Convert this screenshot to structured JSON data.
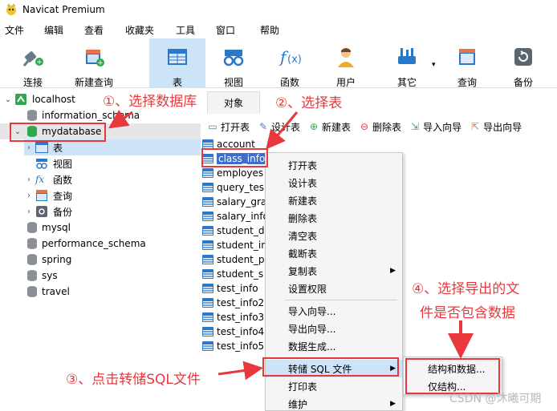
{
  "app": {
    "title": "Navicat Premium"
  },
  "menu": [
    "文件",
    "编辑",
    "查看",
    "收藏夹",
    "工具",
    "窗口",
    "帮助"
  ],
  "toolbar": [
    {
      "label": "连接",
      "icon": "plug-icon"
    },
    {
      "label": "新建查询",
      "icon": "new-query-icon"
    },
    {
      "label": "表",
      "icon": "table-icon"
    },
    {
      "label": "视图",
      "icon": "view-icon"
    },
    {
      "label": "函数",
      "icon": "function-icon"
    },
    {
      "label": "用户",
      "icon": "user-icon"
    },
    {
      "label": "其它",
      "icon": "tools-icon"
    },
    {
      "label": "查询",
      "icon": "query-icon"
    },
    {
      "label": "备份",
      "icon": "backup-icon"
    }
  ],
  "tree": {
    "connection": "localhost",
    "items": [
      "information_schema",
      "mydatabase",
      "表",
      "视图",
      "函数",
      "查询",
      "备份",
      "mysql",
      "performance_schema",
      "spring",
      "sys",
      "travel"
    ]
  },
  "objects": {
    "tab": "对象",
    "actions": [
      "打开表",
      "设计表",
      "新建表",
      "删除表",
      "导入向导",
      "导出向导"
    ],
    "tables": [
      "account",
      "class_info",
      "employes",
      "query_tes",
      "salary_gra",
      "salary_info",
      "student_d",
      "student_in",
      "student_p",
      "student_s",
      "test_info",
      "test_info2",
      "test_info3",
      "test_info4",
      "test_info5"
    ]
  },
  "context_menu": {
    "items": [
      "打开表",
      "设计表",
      "新建表",
      "删除表",
      "清空表",
      "截断表",
      "复制表",
      "设置权限",
      "导入向导...",
      "导出向导...",
      "数据生成...",
      "转储 SQL 文件",
      "打印表",
      "维护"
    ],
    "submenu": [
      "结构和数据...",
      "仅结构..."
    ]
  },
  "annotations": {
    "step1": "①、选择数据库",
    "step2": "②、选择表",
    "step3": "③、点击转储SQL文件",
    "step4_line1": "④、选择导出的文",
    "step4_line2": "件是否包含数据"
  },
  "watermark": "CSDN @沐曦可期",
  "colors": {
    "annotation": "#e8383d",
    "selection": "#3d6ec9",
    "toolbar_active": "#cde3f7"
  }
}
